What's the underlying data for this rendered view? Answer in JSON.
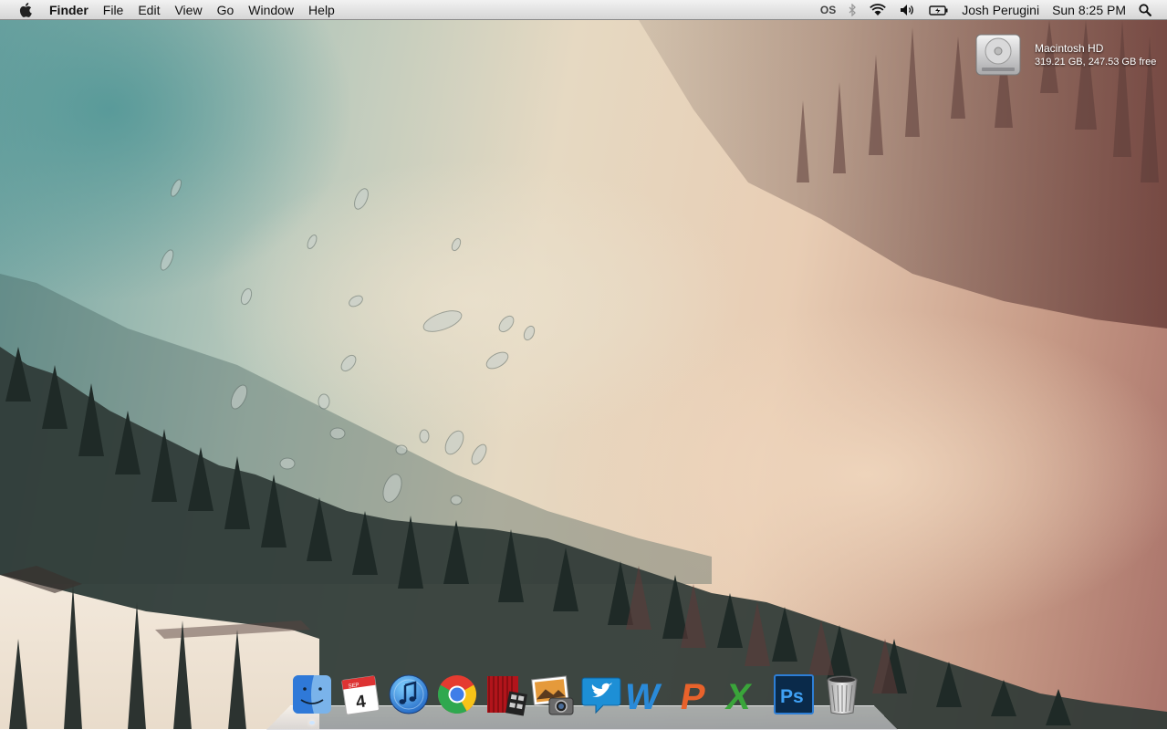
{
  "menubar": {
    "apple_icon": "apple-icon",
    "app_name": "Finder",
    "menus": [
      "File",
      "Edit",
      "View",
      "Go",
      "Window",
      "Help"
    ],
    "status_icons": [
      "lastfm-icon",
      "bluetooth-icon",
      "wifi-icon",
      "volume-icon",
      "battery-icon"
    ],
    "lastfm_label": "OS",
    "user_name": "Josh Perugini",
    "clock": "Sun 8:25 PM",
    "spotlight_icon": "spotlight-search-icon"
  },
  "desktop": {
    "drive": {
      "name": "Macintosh HD",
      "info": "319.21 GB, 247.53 GB free",
      "icon": "hard-drive-icon"
    }
  },
  "dock": {
    "items": [
      {
        "name": "Finder",
        "icon": "finder-icon",
        "running": true
      },
      {
        "name": "Calendar",
        "icon": "calendar-icon",
        "month": "SEP",
        "day": "4"
      },
      {
        "name": "iTunes",
        "icon": "itunes-icon"
      },
      {
        "name": "Google Chrome",
        "icon": "chrome-icon"
      },
      {
        "name": "Photo Booth",
        "icon": "photo-booth-icon"
      },
      {
        "name": "iPhoto",
        "icon": "iphoto-icon"
      },
      {
        "name": "Twitter",
        "icon": "twitter-icon"
      },
      {
        "name": "Word",
        "icon": "word-icon",
        "letter": "W"
      },
      {
        "name": "PowerPoint",
        "icon": "powerpoint-icon",
        "letter": "P"
      },
      {
        "name": "Excel",
        "icon": "excel-icon",
        "letter": "X"
      },
      {
        "name": "Photoshop",
        "icon": "photoshop-icon",
        "letter": "Ps"
      },
      {
        "name": "Trash",
        "icon": "trash-icon"
      }
    ]
  },
  "colors": {
    "menubar_top": "#f2f2f2",
    "menubar_bottom": "#d6d6d6",
    "wallpaper_teal": "#6fa3a1",
    "wallpaper_cream": "#e6d9c2",
    "wallpaper_rose": "#a97269",
    "forest": "#2f3a36"
  }
}
